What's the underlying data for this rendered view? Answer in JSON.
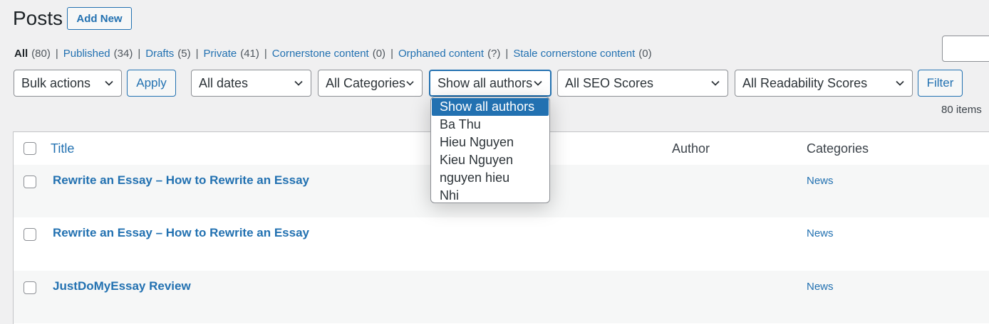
{
  "header": {
    "title": "Posts",
    "add_new_label": "Add New"
  },
  "views": [
    {
      "label": "All",
      "count": "(80)",
      "current": true
    },
    {
      "label": "Published",
      "count": "(34)"
    },
    {
      "label": "Drafts",
      "count": "(5)"
    },
    {
      "label": "Private",
      "count": "(41)"
    },
    {
      "label": "Cornerstone content",
      "count": "(0)"
    },
    {
      "label": "Orphaned content",
      "count": "(?)"
    },
    {
      "label": "Stale cornerstone content",
      "count": "(0)"
    }
  ],
  "filters": {
    "bulk_actions": "Bulk actions",
    "apply_label": "Apply",
    "dates": "All dates",
    "categories": "All Categories",
    "authors": "Show all authors",
    "seo": "All SEO Scores",
    "readability": "All Readability Scores",
    "filter_label": "Filter"
  },
  "items_count": "80 items",
  "author_options": [
    "Show all authors",
    "Ba Thu",
    "Hieu Nguyen",
    "Kieu Nguyen",
    "nguyen hieu",
    "Nhi"
  ],
  "table": {
    "columns": {
      "title": "Title",
      "author": "Author",
      "categories": "Categories"
    },
    "rows": [
      {
        "title": "Rewrite an Essay – How to Rewrite an Essay",
        "category": "News"
      },
      {
        "title": "Rewrite an Essay – How to Rewrite an Essay",
        "category": "News"
      },
      {
        "title": "JustDoMyEssay Review",
        "category": "News"
      }
    ]
  },
  "colors": {
    "accent": "#2271b1",
    "background": "#f0f0f1"
  }
}
